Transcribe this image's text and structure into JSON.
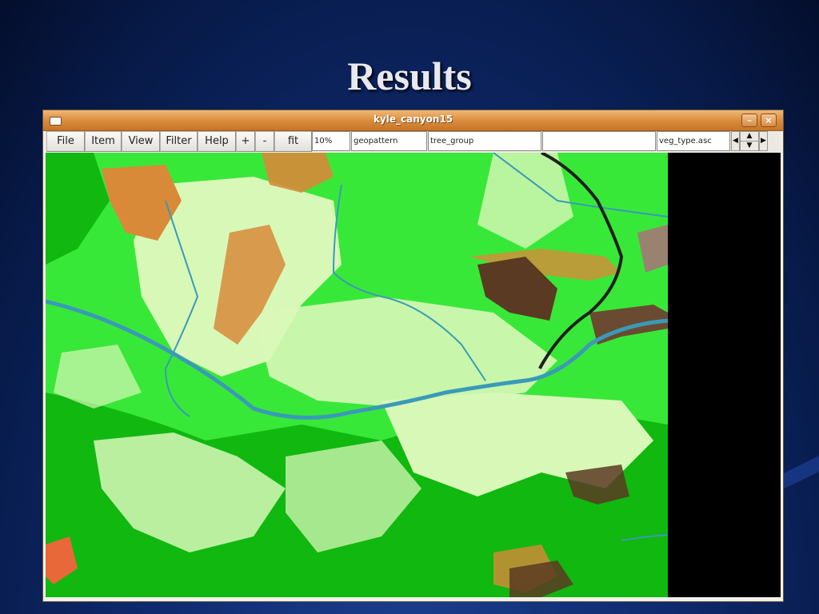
{
  "slide": {
    "title": "Results",
    "background_color": "#0f2a6e"
  },
  "window": {
    "title": "kyle_canyon15",
    "menu_icon": "window-menu-icon",
    "minimize_icon": "minimize-icon",
    "close_icon": "close-icon",
    "titlebar_color": "#d98a3a"
  },
  "toolbar": {
    "menus": [
      "File",
      "Item",
      "View",
      "Filter",
      "Help"
    ],
    "zoom_in": "+",
    "zoom_out": "-",
    "fit": "fit",
    "zoom_value": "10%",
    "fields": [
      "geopattern",
      "tree_group",
      "",
      "veg_type.asc"
    ],
    "nav_icons": [
      "arrow-left-icon",
      "arrow-up-icon",
      "arrow-down-icon",
      "arrow-right-icon"
    ]
  },
  "map": {
    "description_layer": "veg_type.asc",
    "colors": {
      "light_green": "#38e838",
      "dark_green": "#10b810",
      "pale_green": "#d8f8b8",
      "orange": "#d88a38",
      "brown": "#5a3a22",
      "stream": "#3a9ab8",
      "road": "#202020",
      "background": "#000000"
    }
  }
}
